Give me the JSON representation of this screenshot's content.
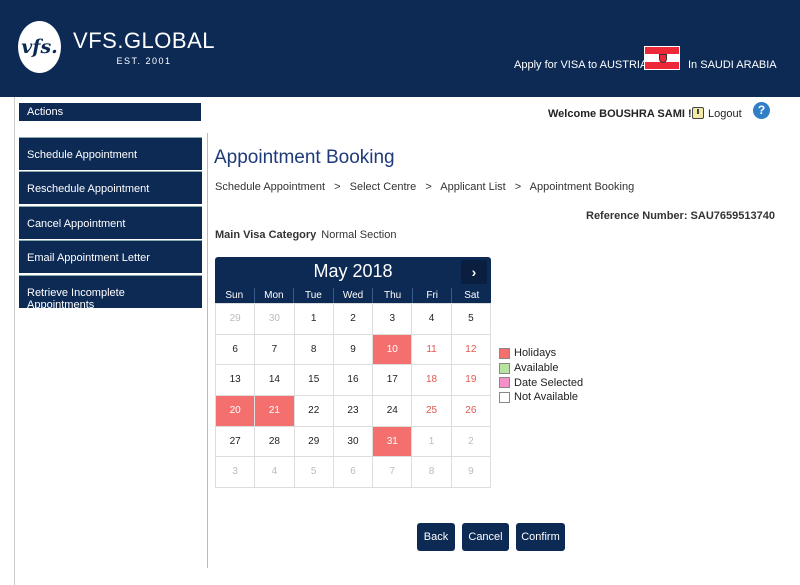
{
  "header": {
    "logo_mark": "vfs.",
    "logo_name": "VFS.GLOBAL",
    "logo_est": "EST. 2001",
    "apply_text": "Apply for VISA to AUSTRIA",
    "in_text": "In SAUDI ARABIA"
  },
  "sidebar": {
    "actions_label": "Actions",
    "items": [
      {
        "label": "Schedule Appointment"
      },
      {
        "label": "Reschedule Appointment"
      },
      {
        "label": "Cancel Appointment"
      },
      {
        "label": "Email Appointment Letter"
      },
      {
        "label": "Retrieve Incomplete Appointments"
      }
    ]
  },
  "topbar": {
    "welcome": "Welcome BOUSHRA SAMI !",
    "logout": "Logout",
    "help": "?"
  },
  "main": {
    "title": "Appointment Booking",
    "breadcrumb": [
      "Schedule Appointment",
      "Select Centre",
      "Applicant List",
      "Appointment Booking"
    ],
    "breadcrumb_sep": ">",
    "reference": "Reference Number: SAU7659513740",
    "category_label": "Main Visa Category",
    "category_value": "Normal Section"
  },
  "calendar": {
    "month": "May 2018",
    "next": "›",
    "days": [
      "Sun",
      "Mon",
      "Tue",
      "Wed",
      "Thu",
      "Fri",
      "Sat"
    ],
    "cells": [
      {
        "d": "29",
        "t": "other"
      },
      {
        "d": "30",
        "t": "other"
      },
      {
        "d": "1",
        "t": ""
      },
      {
        "d": "2",
        "t": ""
      },
      {
        "d": "3",
        "t": ""
      },
      {
        "d": "4",
        "t": ""
      },
      {
        "d": "5",
        "t": ""
      },
      {
        "d": "6",
        "t": ""
      },
      {
        "d": "7",
        "t": ""
      },
      {
        "d": "8",
        "t": ""
      },
      {
        "d": "9",
        "t": ""
      },
      {
        "d": "10",
        "t": "holiday"
      },
      {
        "d": "11",
        "t": "weekend"
      },
      {
        "d": "12",
        "t": "weekend"
      },
      {
        "d": "13",
        "t": ""
      },
      {
        "d": "14",
        "t": ""
      },
      {
        "d": "15",
        "t": ""
      },
      {
        "d": "16",
        "t": ""
      },
      {
        "d": "17",
        "t": ""
      },
      {
        "d": "18",
        "t": "weekend"
      },
      {
        "d": "19",
        "t": "weekend"
      },
      {
        "d": "20",
        "t": "holiday"
      },
      {
        "d": "21",
        "t": "holiday"
      },
      {
        "d": "22",
        "t": ""
      },
      {
        "d": "23",
        "t": ""
      },
      {
        "d": "24",
        "t": ""
      },
      {
        "d": "25",
        "t": "weekend"
      },
      {
        "d": "26",
        "t": "weekend"
      },
      {
        "d": "27",
        "t": ""
      },
      {
        "d": "28",
        "t": ""
      },
      {
        "d": "29",
        "t": ""
      },
      {
        "d": "30",
        "t": ""
      },
      {
        "d": "31",
        "t": "holiday"
      },
      {
        "d": "1",
        "t": "other"
      },
      {
        "d": "2",
        "t": "other"
      },
      {
        "d": "3",
        "t": "other"
      },
      {
        "d": "4",
        "t": "other"
      },
      {
        "d": "5",
        "t": "other"
      },
      {
        "d": "6",
        "t": "other"
      },
      {
        "d": "7",
        "t": "other"
      },
      {
        "d": "8",
        "t": "other"
      },
      {
        "d": "9",
        "t": "other"
      }
    ]
  },
  "legend": [
    {
      "label": "Holidays",
      "color": "#f4706e"
    },
    {
      "label": "Available",
      "color": "#b9e4a0"
    },
    {
      "label": "Date Selected",
      "color": "#f590c8"
    },
    {
      "label": "Not Available",
      "color": "#ffffff"
    }
  ],
  "buttons": {
    "back": "Back",
    "cancel": "Cancel",
    "confirm": "Confirm"
  },
  "colors": {
    "brand": "#0d2a55",
    "holiday": "#f4706e",
    "weekend_text": "#e0574f"
  }
}
